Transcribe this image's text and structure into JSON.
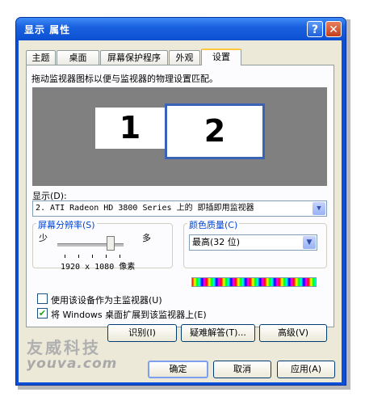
{
  "window": {
    "title": "显示 属性",
    "help_icon": "help-icon",
    "close_icon": "close-icon"
  },
  "tabs": [
    {
      "label": "主题"
    },
    {
      "label": "桌面"
    },
    {
      "label": "屏幕保护程序"
    },
    {
      "label": "外观"
    },
    {
      "label": "设置"
    }
  ],
  "settings": {
    "instruction": "拖动监视器图标以便与监视器的物理设置匹配。",
    "monitors": [
      {
        "label": "1"
      },
      {
        "label": "2"
      }
    ],
    "display_label": "显示(D):",
    "display_value": "2. ATI Radeon HD 3800 Series  上的 即插即用监视器",
    "resolution": {
      "legend": "屏幕分辨率(S)",
      "less": "少",
      "more": "多",
      "value": "1920 x 1080 像素",
      "slider_fraction": 0.8
    },
    "color": {
      "legend": "颜色质量(C)",
      "value": "最高(32 位)"
    },
    "primary_checkbox": {
      "label": "使用该设备作为主监视器(U)",
      "checked": false
    },
    "extend_checkbox": {
      "label": "将 Windows 桌面扩展到该监视器上(E)",
      "checked": true
    },
    "buttons": {
      "identify": "识别(I)",
      "troubleshoot": "疑难解答(T)...",
      "advanced": "高级(V)"
    }
  },
  "footer": {
    "ok": "确定",
    "cancel": "取消",
    "apply": "应用(A)"
  },
  "watermark": {
    "cn": "友威科技",
    "url": "youva.com"
  },
  "colors": {
    "title_bar": "#0a4fd6",
    "dialog_bg": "#ece9d8",
    "group_legend": "#0046d5",
    "monitor_area": "#808080"
  }
}
